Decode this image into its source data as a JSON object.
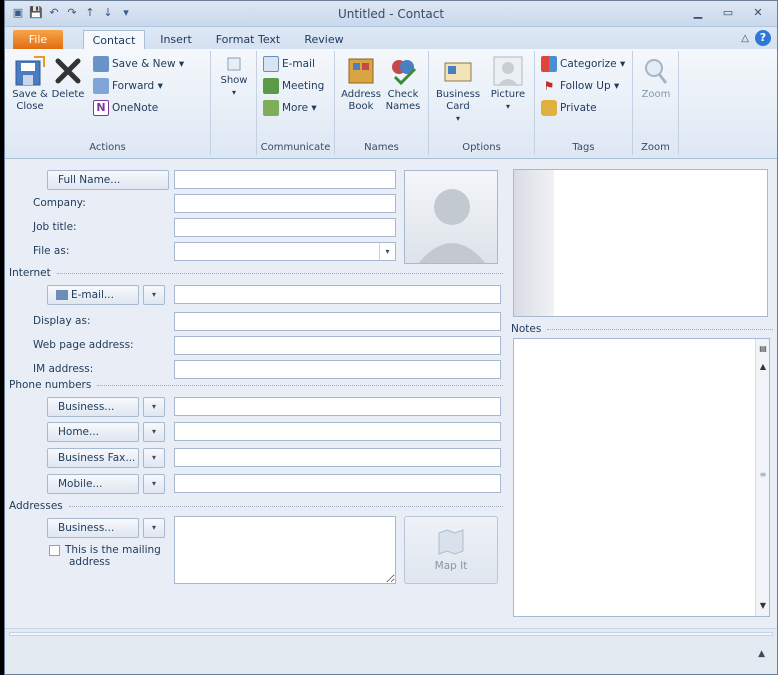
{
  "window": {
    "title": "Untitled - Contact"
  },
  "tabs": [
    "File",
    "Contact",
    "Insert",
    "Format Text",
    "Review"
  ],
  "ribbon": {
    "actions": {
      "save_close": "Save &\nClose",
      "delete": "Delete",
      "save_new": "Save & New ▾",
      "forward": "Forward ▾",
      "onenote": "OneNote",
      "label": "Actions"
    },
    "show": {
      "label": "Show"
    },
    "communicate": {
      "email": "E-mail",
      "meeting": "Meeting",
      "more": "More ▾",
      "label": "Communicate"
    },
    "names": {
      "address_book": "Address\nBook",
      "check_names": "Check\nNames",
      "label": "Names"
    },
    "options": {
      "business_card": "Business\nCard",
      "picture": "Picture",
      "label": "Options"
    },
    "tags": {
      "categorize": "Categorize ▾",
      "follow_up": "Follow Up ▾",
      "private": "Private",
      "label": "Tags"
    },
    "zoom": {
      "zoom": "Zoom",
      "label": "Zoom"
    }
  },
  "form": {
    "full_name": "Full Name...",
    "company": "Company:",
    "job_title": "Job title:",
    "file_as": "File as:",
    "internet": "Internet",
    "email_btn": "E-mail...",
    "display_as": "Display as:",
    "web_page": "Web page address:",
    "im_address": "IM address:",
    "phone_numbers": "Phone numbers",
    "business": "Business...",
    "home": "Home...",
    "business_fax": "Business Fax...",
    "mobile": "Mobile...",
    "addresses": "Addresses",
    "addr_business": "Business...",
    "mailing_line1": "This is the mailing",
    "mailing_line2": "address",
    "map_it": "Map It",
    "notes": "Notes"
  }
}
